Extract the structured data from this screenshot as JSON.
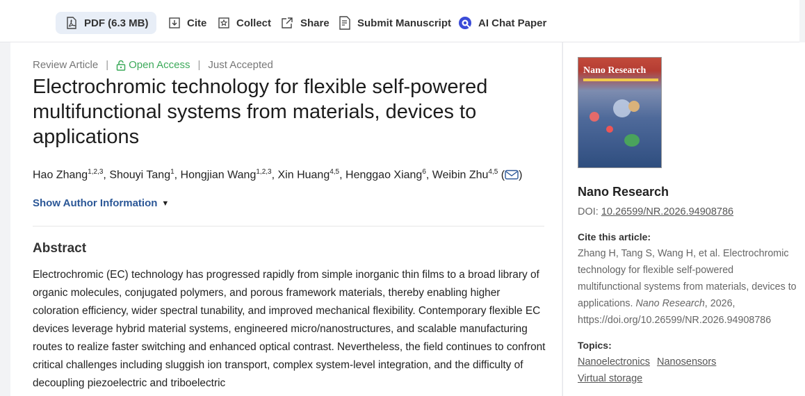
{
  "toolbar": {
    "pdf_label": "PDF (6.3 MB)",
    "cite_label": "Cite",
    "collect_label": "Collect",
    "share_label": "Share",
    "submit_label": "Submit Manuscript",
    "ai_chat_label": "AI Chat Paper"
  },
  "article": {
    "type": "Review Article",
    "access": "Open Access",
    "status": "Just Accepted",
    "title": "Electrochromic technology for flexible self-powered multifunctional systems from materials, devices to applications",
    "authors": [
      {
        "name": "Hao Zhang",
        "aff": "1,2,3"
      },
      {
        "name": "Shouyi Tang",
        "aff": "1"
      },
      {
        "name": "Hongjian Wang",
        "aff": "1,2,3"
      },
      {
        "name": "Xin Huang",
        "aff": "4,5"
      },
      {
        "name": "Henggao Xiang",
        "aff": "6"
      },
      {
        "name": "Weibin Zhu",
        "aff": "4,5"
      }
    ],
    "show_author_info": "Show Author Information",
    "abstract_heading": "Abstract",
    "abstract": "Electrochromic (EC) technology has progressed rapidly from simple inorganic thin films to a broad library of organic molecules, conjugated polymers, and porous framework materials, thereby enabling higher coloration efficiency, wider spectral tunability, and improved mechanical flexibility. Contemporary flexible EC devices leverage hybrid material systems, engineered micro/nanostructures, and scalable manufacturing routes to realize faster switching and enhanced optical contrast. Nevertheless, the field continues to confront critical challenges including sluggish ion transport, complex system-level integration, and the difficulty of decoupling piezoelectric and triboelectric"
  },
  "sidebar": {
    "cover_title": "Nano Research",
    "journal": "Nano Research",
    "doi_prefix": "DOI: ",
    "doi": "10.26599/NR.2026.94908786",
    "cite_heading": "Cite this article:",
    "cite_pre": "Zhang H, Tang S, Wang H, et al. Electrochromic technology for flexible self-powered multifunctional systems from materials, devices to applications. ",
    "cite_journal": "Nano Research",
    "cite_post": ", 2026, https://doi.org/10.26599/NR.2026.94908786",
    "topics_heading": "Topics:",
    "topics": [
      "Nanoelectronics",
      "Nanosensors",
      "Virtual storage"
    ]
  },
  "colors": {
    "accent_link": "#2b5797",
    "open_access": "#3caa5a",
    "pdf_bg": "#e8eef7"
  }
}
